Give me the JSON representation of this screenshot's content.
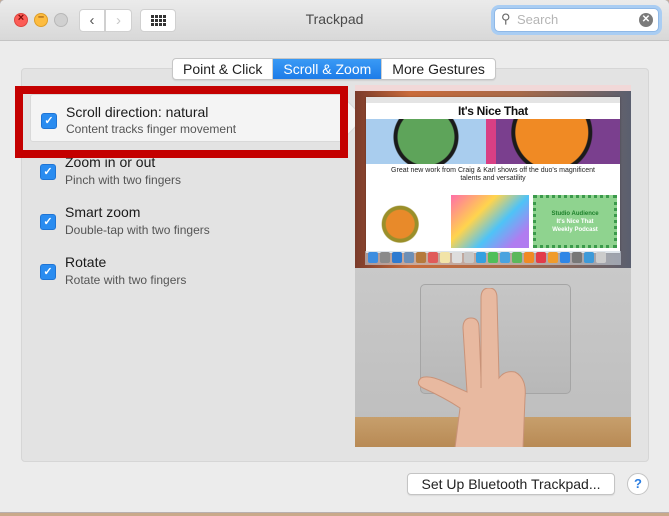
{
  "window": {
    "title": "Trackpad",
    "traffic_lights": {
      "close_glyph": "×",
      "minimize_glyph": "–"
    },
    "nav": {
      "back_glyph": "‹",
      "forward_glyph": "›",
      "show_all_icon": "grid-icon"
    }
  },
  "search": {
    "placeholder": "Search",
    "value": "",
    "icon": "magnifier-icon",
    "clear_glyph": "✕"
  },
  "tabs": [
    {
      "label": "Point & Click",
      "active": false
    },
    {
      "label": "Scroll & Zoom",
      "active": true
    },
    {
      "label": "More Gestures",
      "active": false
    }
  ],
  "options": [
    {
      "label": "Scroll direction: natural",
      "description": "Content tracks finger movement",
      "checked": true,
      "selected": true
    },
    {
      "label": "Zoom in or out",
      "description": "Pinch with two fingers",
      "checked": true,
      "selected": false
    },
    {
      "label": "Smart zoom",
      "description": "Double-tap with two fingers",
      "checked": true,
      "selected": false
    },
    {
      "label": "Rotate",
      "description": "Rotate with two fingers",
      "checked": true,
      "selected": false
    }
  ],
  "checkmark_glyph": "✓",
  "preview": {
    "site_title": "It's Nice That",
    "headline": "Great new work from Craig & Karl shows off the duo's magnificent talents and versatility",
    "promo_lines": [
      "Studio Audience",
      "It's Nice That",
      "Weekly Podcast"
    ]
  },
  "annotation": {
    "highlight_color": "#c40000"
  },
  "footer": {
    "setup_button": "Set Up Bluetooth Trackpad...",
    "help_glyph": "?"
  },
  "colors": {
    "accent": "#1d7ce8",
    "checkbox": "#2a8cf0"
  }
}
